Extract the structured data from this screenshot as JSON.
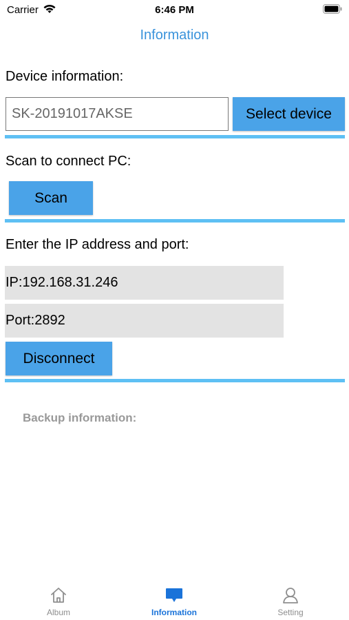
{
  "status_bar": {
    "carrier": "Carrier",
    "time": "6:46 PM"
  },
  "nav": {
    "title": "Information"
  },
  "device": {
    "label": "Device information:",
    "input_value": "SK-20191017AKSE",
    "select_button": "Select device"
  },
  "scan": {
    "label": "Scan to connect PC:",
    "button": "Scan"
  },
  "ip": {
    "label": "Enter the IP address and port:",
    "ip_field": "IP:192.168.31.246",
    "port_field": "Port:2892",
    "disconnect_button": "Disconnect"
  },
  "backup": {
    "label": "Backup information:"
  },
  "tab_bar": {
    "items": [
      {
        "label": "Album",
        "icon": "home-icon",
        "active": false
      },
      {
        "label": "Information",
        "icon": "chat-bubble-icon",
        "active": true
      },
      {
        "label": "Setting",
        "icon": "person-icon",
        "active": false
      }
    ]
  },
  "colors": {
    "accent": "#4aa3e8",
    "divider": "#5ec0f4",
    "title": "#3a93db",
    "tab_active": "#1a73d9"
  }
}
